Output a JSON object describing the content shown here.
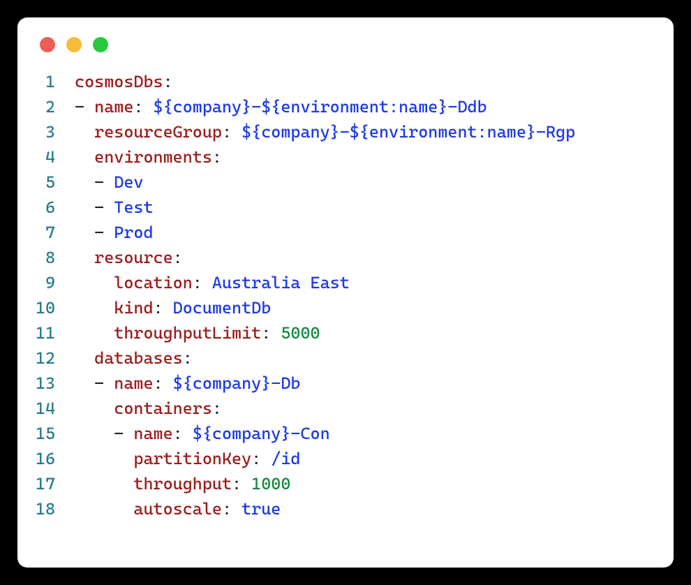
{
  "window": {
    "dot_colors": {
      "red": "#ec5f59",
      "yellow": "#f6bd3b",
      "green": "#27c93f"
    }
  },
  "code": {
    "lines": [
      {
        "num": "1",
        "tokens": [
          {
            "t": "cosmosDbs",
            "c": "key"
          },
          {
            "t": ":",
            "c": "punct"
          }
        ]
      },
      {
        "num": "2",
        "tokens": [
          {
            "t": "- ",
            "c": "plain"
          },
          {
            "t": "name",
            "c": "key"
          },
          {
            "t": ": ",
            "c": "punct"
          },
          {
            "t": "${company}-${environment:name}-Ddb",
            "c": "str"
          }
        ]
      },
      {
        "num": "3",
        "tokens": [
          {
            "t": "  ",
            "c": "plain"
          },
          {
            "t": "resourceGroup",
            "c": "key"
          },
          {
            "t": ": ",
            "c": "punct"
          },
          {
            "t": "${company}-${environment:name}-Rgp",
            "c": "str"
          }
        ]
      },
      {
        "num": "4",
        "tokens": [
          {
            "t": "  ",
            "c": "plain"
          },
          {
            "t": "environments",
            "c": "key"
          },
          {
            "t": ":",
            "c": "punct"
          }
        ]
      },
      {
        "num": "5",
        "tokens": [
          {
            "t": "  - ",
            "c": "plain"
          },
          {
            "t": "Dev",
            "c": "str"
          }
        ]
      },
      {
        "num": "6",
        "tokens": [
          {
            "t": "  - ",
            "c": "plain"
          },
          {
            "t": "Test",
            "c": "str"
          }
        ]
      },
      {
        "num": "7",
        "tokens": [
          {
            "t": "  - ",
            "c": "plain"
          },
          {
            "t": "Prod",
            "c": "str"
          }
        ]
      },
      {
        "num": "8",
        "tokens": [
          {
            "t": "  ",
            "c": "plain"
          },
          {
            "t": "resource",
            "c": "key"
          },
          {
            "t": ":",
            "c": "punct"
          }
        ]
      },
      {
        "num": "9",
        "tokens": [
          {
            "t": "    ",
            "c": "plain"
          },
          {
            "t": "location",
            "c": "key"
          },
          {
            "t": ": ",
            "c": "punct"
          },
          {
            "t": "Australia East",
            "c": "str"
          }
        ]
      },
      {
        "num": "10",
        "tokens": [
          {
            "t": "    ",
            "c": "plain"
          },
          {
            "t": "kind",
            "c": "key"
          },
          {
            "t": ": ",
            "c": "punct"
          },
          {
            "t": "DocumentDb",
            "c": "str"
          }
        ]
      },
      {
        "num": "11",
        "tokens": [
          {
            "t": "    ",
            "c": "plain"
          },
          {
            "t": "throughputLimit",
            "c": "key"
          },
          {
            "t": ": ",
            "c": "punct"
          },
          {
            "t": "5000",
            "c": "num"
          }
        ]
      },
      {
        "num": "12",
        "tokens": [
          {
            "t": "  ",
            "c": "plain"
          },
          {
            "t": "databases",
            "c": "key"
          },
          {
            "t": ":",
            "c": "punct"
          }
        ]
      },
      {
        "num": "13",
        "tokens": [
          {
            "t": "  - ",
            "c": "plain"
          },
          {
            "t": "name",
            "c": "key"
          },
          {
            "t": ": ",
            "c": "punct"
          },
          {
            "t": "${company}-Db",
            "c": "str"
          }
        ]
      },
      {
        "num": "14",
        "tokens": [
          {
            "t": "    ",
            "c": "plain"
          },
          {
            "t": "containers",
            "c": "key"
          },
          {
            "t": ":",
            "c": "punct"
          }
        ]
      },
      {
        "num": "15",
        "tokens": [
          {
            "t": "    - ",
            "c": "plain"
          },
          {
            "t": "name",
            "c": "key"
          },
          {
            "t": ": ",
            "c": "punct"
          },
          {
            "t": "${company}-Con",
            "c": "str"
          }
        ]
      },
      {
        "num": "16",
        "tokens": [
          {
            "t": "      ",
            "c": "plain"
          },
          {
            "t": "partitionKey",
            "c": "key"
          },
          {
            "t": ": ",
            "c": "punct"
          },
          {
            "t": "/id",
            "c": "str"
          }
        ]
      },
      {
        "num": "17",
        "tokens": [
          {
            "t": "      ",
            "c": "plain"
          },
          {
            "t": "throughput",
            "c": "key"
          },
          {
            "t": ": ",
            "c": "punct"
          },
          {
            "t": "1000",
            "c": "num"
          }
        ]
      },
      {
        "num": "18",
        "tokens": [
          {
            "t": "      ",
            "c": "plain"
          },
          {
            "t": "autoscale",
            "c": "key"
          },
          {
            "t": ": ",
            "c": "punct"
          },
          {
            "t": "true",
            "c": "bool"
          }
        ]
      }
    ]
  }
}
